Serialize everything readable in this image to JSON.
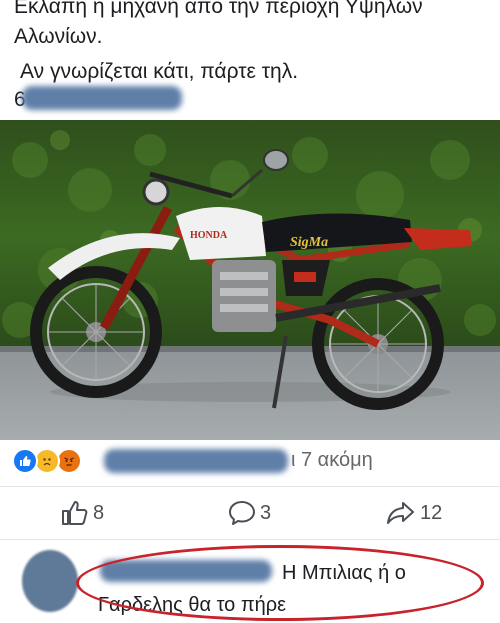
{
  "post": {
    "line1": "Εκλάπη η μηχανή από την περιοχή Υψηλών",
    "line2": "Αλωνίων.",
    "line3": "Αν γνωρίζεται κάτι, πάρτε τηλ.",
    "line4": "6"
  },
  "photo": {
    "brand": "HONDA",
    "seat_text": "SigMa"
  },
  "reactions": {
    "icons": [
      "like-icon",
      "sad-icon",
      "angry-icon"
    ],
    "more_text": "ι 7 ακόμη"
  },
  "actions": {
    "likes": "8",
    "comments": "3",
    "shares": "12"
  },
  "comment": {
    "line1_tail": "Η Μπιλιας ή ο",
    "line2": "Γαρδελης θα το πήρε"
  },
  "colors": {
    "like": "#1877f2",
    "reaction_yellow": "#f7b928",
    "angry": "#e9710f",
    "highlight_circle": "#c8222a",
    "redaction": "#5f7fa8"
  }
}
